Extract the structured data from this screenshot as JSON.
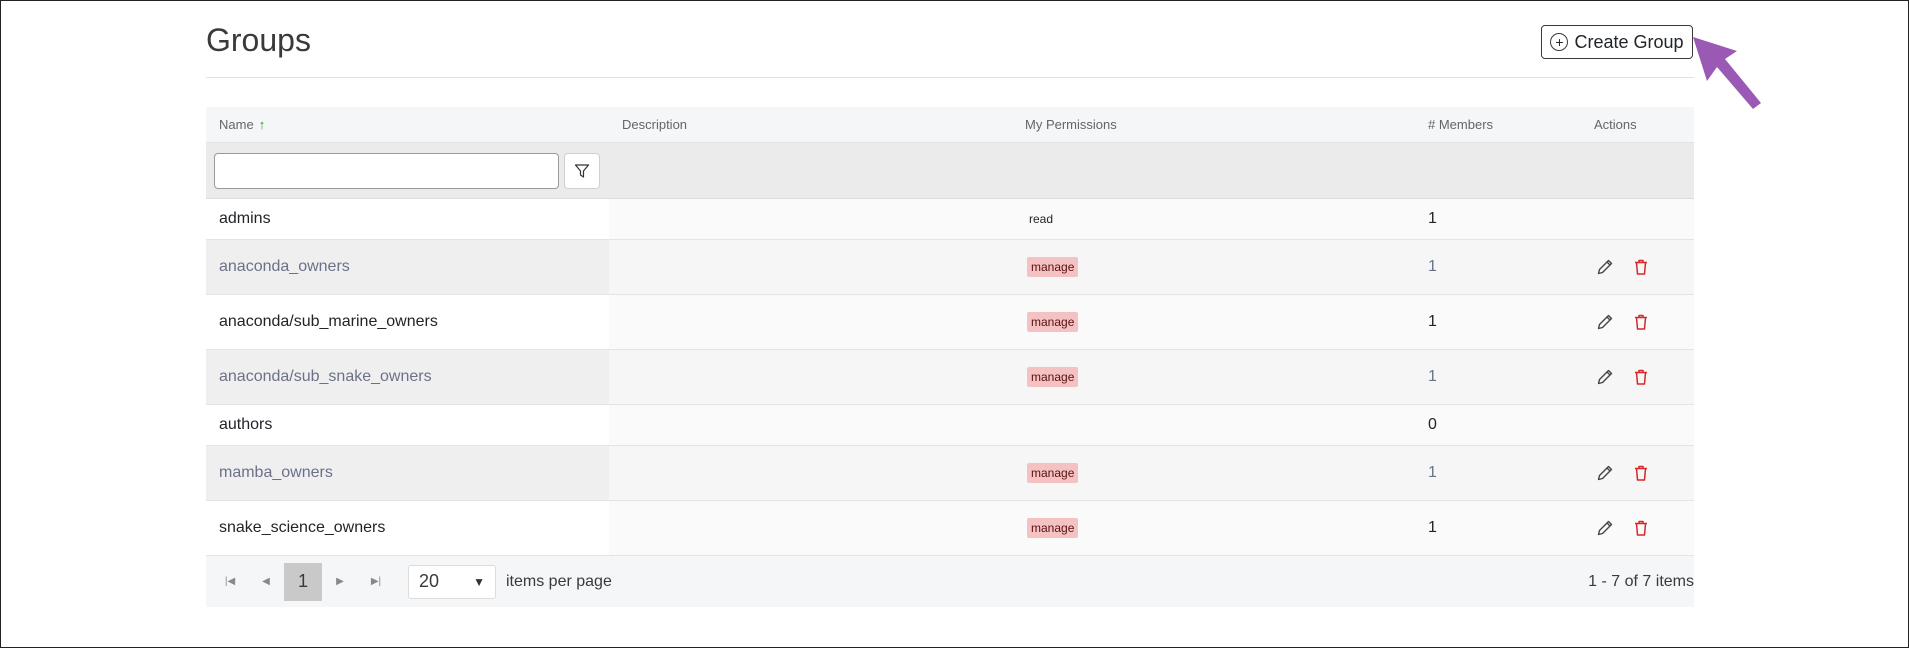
{
  "page": {
    "title": "Groups"
  },
  "toolbar": {
    "create_label": "Create Group"
  },
  "table": {
    "columns": {
      "name": "Name",
      "description": "Description",
      "permissions": "My Permissions",
      "members": "# Members",
      "actions": "Actions"
    },
    "filter_placeholder": "",
    "rows": [
      {
        "name": "admins",
        "description": "",
        "permission": "read",
        "members": "1",
        "editable": false
      },
      {
        "name": "anaconda_owners",
        "description": "",
        "permission": "manage",
        "members": "1",
        "editable": true
      },
      {
        "name": "anaconda/sub_marine_owners",
        "description": "",
        "permission": "manage",
        "members": "1",
        "editable": true
      },
      {
        "name": "anaconda/sub_snake_owners",
        "description": "",
        "permission": "manage",
        "members": "1",
        "editable": true
      },
      {
        "name": "authors",
        "description": "",
        "permission": "",
        "members": "0",
        "editable": false
      },
      {
        "name": "mamba_owners",
        "description": "",
        "permission": "manage",
        "members": "1",
        "editable": true
      },
      {
        "name": "snake_science_owners",
        "description": "",
        "permission": "manage",
        "members": "1",
        "editable": true
      }
    ]
  },
  "pager": {
    "current_page": "1",
    "page_size": "20",
    "per_page_label": "items per page",
    "summary": "1 - 7 of 7 items"
  },
  "icons": {
    "plus": "plus-circle-icon",
    "filter": "filter-icon",
    "edit": "pencil-icon",
    "delete": "trash-icon",
    "sort": "sort-up-icon"
  },
  "colors": {
    "accent_arrow": "#9b59b6",
    "badge_manage": "#f4c2c2",
    "delete_red": "#d62828"
  }
}
